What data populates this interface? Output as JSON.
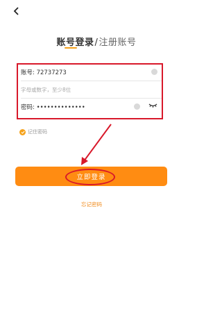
{
  "nav": {
    "back_icon": "chevron-left-icon"
  },
  "tabs": {
    "active": "账号登录",
    "separator": "/",
    "inactive": "注册账号"
  },
  "form": {
    "account_label": "账号: 72737273",
    "hint": "字母或数字，至少8位",
    "password_label": "密码: ••••••••••••••",
    "icons": [
      "clear-icon",
      "eye-closed-icon"
    ]
  },
  "remember": {
    "label": "记住密码",
    "checked": true
  },
  "login_button": {
    "label": "立即登录"
  },
  "forgot_password": {
    "label": "忘记密码"
  },
  "colors": {
    "accent": "#ff8c12",
    "annotation": "#d8182a",
    "hint": "#a8a8a8"
  }
}
